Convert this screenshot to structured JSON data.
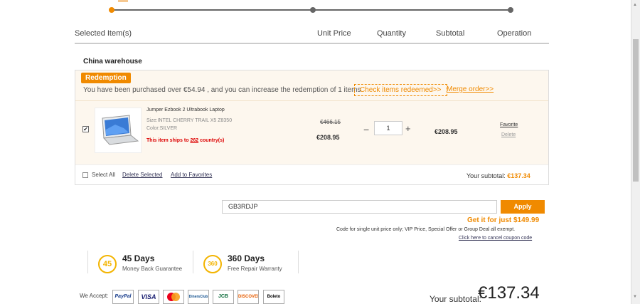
{
  "columns": {
    "selected": "Selected Item(s)",
    "unit_price": "Unit Price",
    "quantity": "Quantity",
    "subtotal": "Subtotal",
    "operation": "Operation"
  },
  "warehouse": "China warehouse",
  "redemption": {
    "badge": "Redemption",
    "text": "You have been purchased over €54.94 , and you can increase the redemption of 1 items",
    "check_link": "Check items redeemed>>",
    "merge_link": "Merge order>>"
  },
  "item": {
    "name": "Jumper Ezbook 2 Ultrabook Laptop",
    "size": "Size:INTEL CHERRY TRAIL X5 Z8350",
    "color": "Color:SILVER",
    "ships_prefix": "This item ships to ",
    "ships_count": "262",
    "ships_suffix": " country(s)",
    "old_price": "€466.15",
    "unit_price": "€208.95",
    "qty_minus": "−",
    "quantity": "1",
    "qty_plus": "+",
    "subtotal": "€208.95",
    "favorite": "Favorite",
    "delete": "Delete",
    "checked": true
  },
  "footer": {
    "select_all": "Select All",
    "delete_selected": "Delete Selected",
    "add_favorites": "Add to Favorites",
    "your_subtotal_label": "Your subtotal: ",
    "your_subtotal_value": "€137.34"
  },
  "coupon": {
    "code": "GB3RDJP",
    "apply": "Apply",
    "get_it": "Get it for just $149.99",
    "note": "Code for single unit price only; VIP Price, Special Offer or Group Deal all exempt.",
    "cancel": "Click here to cancel coupon code"
  },
  "guarantees": [
    {
      "icon": "45",
      "title": "45 Days",
      "sub": "Money Back Guarantee"
    },
    {
      "icon": "360",
      "title": "360 Days",
      "sub": "Free Repair Warranty"
    }
  ],
  "payment": {
    "we_accept": "We Accept:",
    "methods": [
      "PayPal",
      "VISA",
      "MasterCard",
      "DinersClub",
      "JCB",
      "DISCOVER",
      "Boleto"
    ]
  },
  "total": {
    "label": "Your subtotal:",
    "value": "€137.34"
  },
  "colors": {
    "accent": "#f08a00",
    "warning_red": "#dd0000",
    "icon_gold": "#f3b400"
  }
}
